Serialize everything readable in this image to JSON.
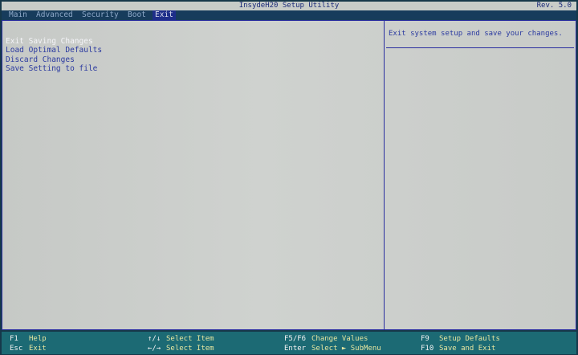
{
  "header": {
    "title": "InsydeH20 Setup Utility",
    "revision": "Rev. 5.0"
  },
  "menu": {
    "tabs": [
      {
        "label": "Main",
        "active": false
      },
      {
        "label": "Advanced",
        "active": false
      },
      {
        "label": "Security",
        "active": false
      },
      {
        "label": "Boot",
        "active": false
      },
      {
        "label": "Exit",
        "active": true
      }
    ]
  },
  "exit_menu": {
    "items": [
      {
        "label": "Exit Saving Changes",
        "selected": true
      },
      {
        "label": "Load Optimal Defaults",
        "selected": false
      },
      {
        "label": "Discard Changes",
        "selected": false
      },
      {
        "label": "Save Setting to file",
        "selected": false
      }
    ]
  },
  "help": {
    "text": "Exit system setup and save your changes."
  },
  "footer": {
    "groups": [
      {
        "lines": [
          {
            "key": "F1",
            "desc": "Help"
          },
          {
            "key": "Esc",
            "desc": "Exit"
          }
        ]
      },
      {
        "lines": [
          {
            "key": "↑/↓",
            "desc": "Select Item"
          },
          {
            "key": "←/→",
            "desc": "Select Item"
          }
        ]
      },
      {
        "lines": [
          {
            "key": "F5/F6",
            "desc": "Change Values"
          },
          {
            "key": "Enter",
            "desc": "Select ► SubMenu"
          }
        ]
      },
      {
        "lines": [
          {
            "key": "F9",
            "desc": "Setup Defaults"
          },
          {
            "key": "F10",
            "desc": "Save and Exit"
          }
        ]
      }
    ]
  },
  "colors": {
    "title_bar": "#c8ccc8",
    "menu_bar": "#173c5c",
    "active_tab": "#1e2e8a",
    "panel_background": "#cfd2cf",
    "item_text": "#2b3aa0",
    "selected_item_text": "#f4f4f8",
    "footer_background": "#1c6a74",
    "footer_key": "#f2f2f2",
    "footer_description": "#e6e6a0"
  }
}
